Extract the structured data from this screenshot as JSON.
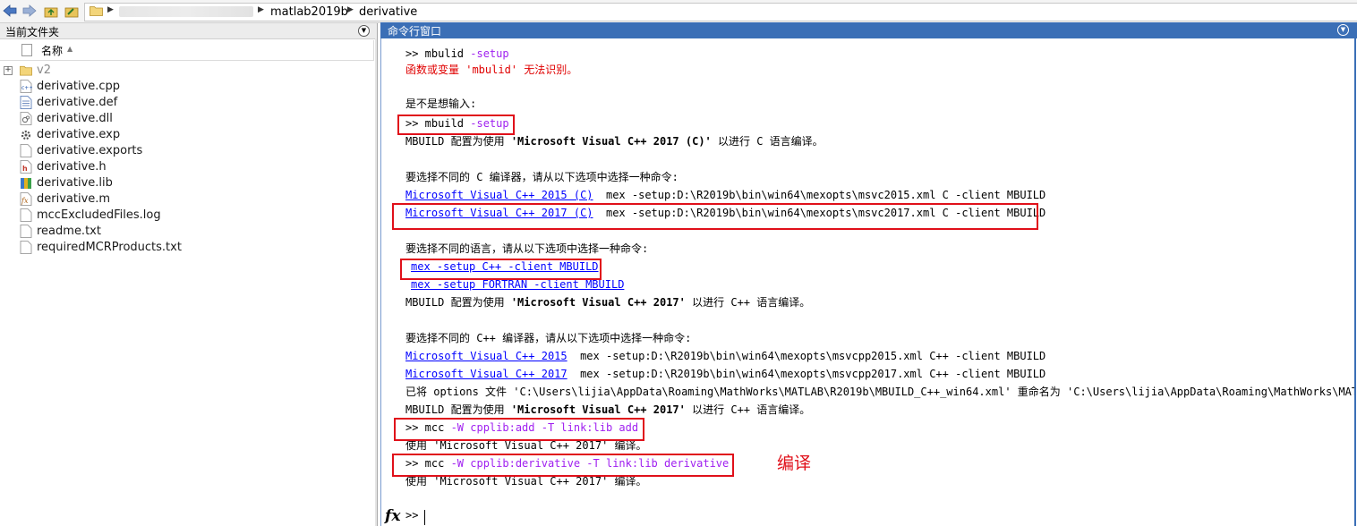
{
  "breadcrumb": {
    "items": [
      "matlab2019b",
      "derivative"
    ]
  },
  "left_panel": {
    "title": "当前文件夹",
    "column_name": "名称",
    "folder": "v2",
    "files": [
      "derivative.cpp",
      "derivative.def",
      "derivative.dll",
      "derivative.exp",
      "derivative.exports",
      "derivative.h",
      "derivative.lib",
      "derivative.m",
      "mccExcludedFiles.log",
      "readme.txt",
      "requiredMCRProducts.txt"
    ]
  },
  "command_window": {
    "title": "命令行窗口",
    "lines": {
      "l1_prompt": ">> mbulid ",
      "l1_arg": "-setup",
      "l2": "函数或变量 'mbulid' 无法识别。",
      "l3": "是不是想输入:",
      "l4_prompt": ">> mbuild ",
      "l4_arg": "-setup",
      "l5_pre": "MBUILD 配置为使用 ",
      "l5_bold": "'Microsoft Visual C++ 2017 (C)'",
      "l5_post": " 以进行 C 语言编译。",
      "l6": "要选择不同的 C 编译器，请从以下选项中选择一种命令:",
      "l7_link": "Microsoft Visual C++ 2015 (C)",
      "l7_rest": "  mex -setup:D:\\R2019b\\bin\\win64\\mexopts\\msvc2015.xml C -client MBUILD",
      "l8_link": "Microsoft Visual C++ 2017 (C)",
      "l8_rest": "  mex -setup:D:\\R2019b\\bin\\win64\\mexopts\\msvc2017.xml C -client MBUILD",
      "l9": "要选择不同的语言，请从以下选项中选择一种命令:",
      "l10_link": "mex -setup C++ -client MBUILD",
      "l11_link": "mex -setup FORTRAN -client MBUILD",
      "l12_pre": "MBUILD 配置为使用 ",
      "l12_bold": "'Microsoft Visual C++ 2017'",
      "l12_post": " 以进行 C++ 语言编译。",
      "l13": "要选择不同的 C++ 编译器，请从以下选项中选择一种命令:",
      "l14_link": "Microsoft Visual C++ 2015",
      "l14_rest": "  mex -setup:D:\\R2019b\\bin\\win64\\mexopts\\msvcpp2015.xml C++ -client MBUILD",
      "l15_link": "Microsoft Visual C++ 2017",
      "l15_rest": "  mex -setup:D:\\R2019b\\bin\\win64\\mexopts\\msvcpp2017.xml C++ -client MBUILD",
      "l16": "已将 options 文件 'C:\\Users\\lijia\\AppData\\Roaming\\MathWorks\\MATLAB\\R2019b\\MBUILD_C++_win64.xml' 重命名为 'C:\\Users\\lijia\\AppData\\Roaming\\MathWorks\\MATLAB",
      "l17_pre": "MBUILD 配置为使用 ",
      "l17_bold": "'Microsoft Visual C++ 2017'",
      "l17_post": " 以进行 C++ 语言编译。",
      "l18_prompt": ">> mcc ",
      "l18_arg": "-W cpplib:add -T link:lib add",
      "l19": "使用 'Microsoft Visual C++ 2017' 编译。",
      "l20_prompt": ">> mcc ",
      "l20_arg": "-W cpplib:derivative -T link:lib derivative",
      "l21": "使用 'Microsoft Visual C++ 2017' 编译。",
      "prompt": ">>"
    },
    "annotation": "编译"
  },
  "colors": {
    "command_header": "#3b6fb6",
    "highlight_box": "#e0101a",
    "keyword": "#a020f0",
    "error": "#e00000",
    "link": "#0000ff"
  }
}
